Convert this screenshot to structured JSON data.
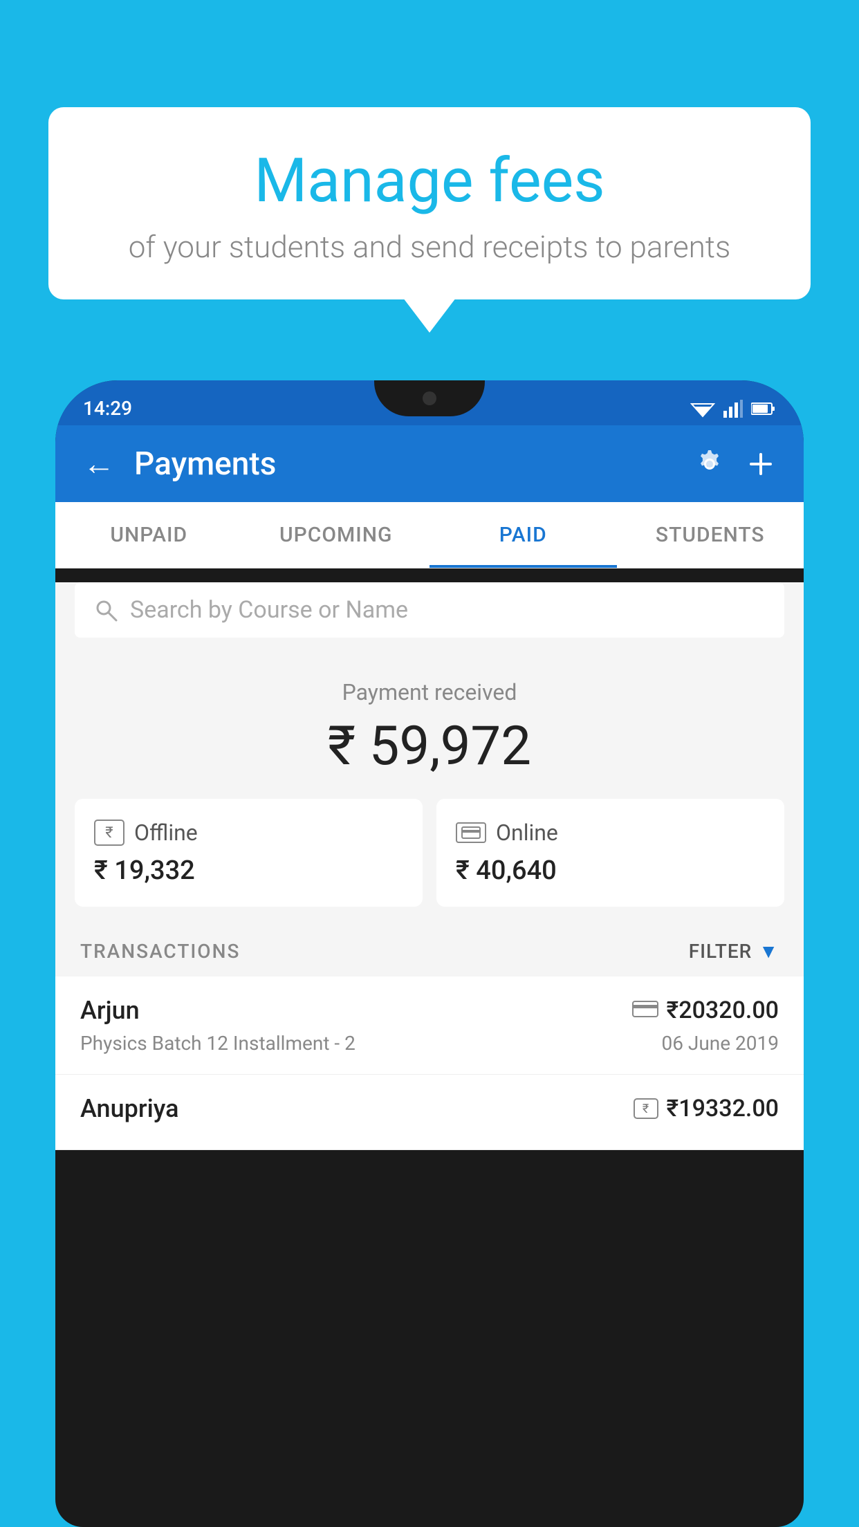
{
  "background_color": "#1ab8e8",
  "bubble": {
    "title": "Manage fees",
    "subtitle": "of your students and send receipts to parents"
  },
  "phone": {
    "status_bar": {
      "time": "14:29"
    },
    "header": {
      "title": "Payments",
      "back_label": "←",
      "gear_icon": "gear-icon",
      "plus_icon": "plus-icon"
    },
    "tabs": [
      {
        "label": "UNPAID",
        "active": false
      },
      {
        "label": "UPCOMING",
        "active": false
      },
      {
        "label": "PAID",
        "active": true
      },
      {
        "label": "STUDENTS",
        "active": false
      }
    ],
    "search": {
      "placeholder": "Search by Course or Name"
    },
    "payment_summary": {
      "label": "Payment received",
      "amount": "₹ 59,972",
      "offline": {
        "label": "Offline",
        "amount": "₹ 19,332"
      },
      "online": {
        "label": "Online",
        "amount": "₹ 40,640"
      }
    },
    "transactions": {
      "label": "TRANSACTIONS",
      "filter_label": "FILTER",
      "rows": [
        {
          "name": "Arjun",
          "sub": "Physics Batch 12 Installment - 2",
          "amount": "₹20320.00",
          "date": "06 June 2019",
          "payment_type": "card"
        },
        {
          "name": "Anupriya",
          "sub": "",
          "amount": "₹19332.00",
          "date": "",
          "payment_type": "rupee"
        }
      ]
    }
  }
}
